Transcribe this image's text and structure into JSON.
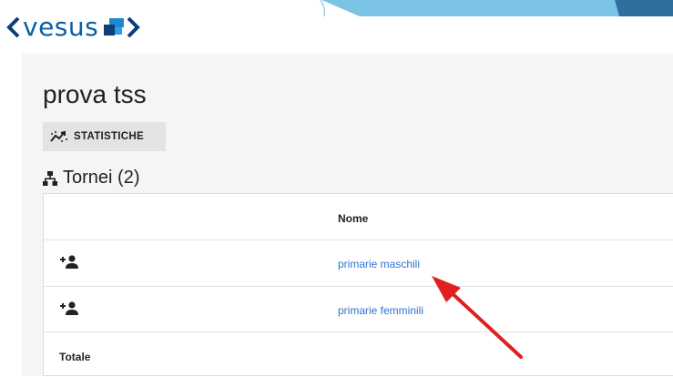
{
  "brand": {
    "logo_text": "vesus"
  },
  "page": {
    "title": "prova tss"
  },
  "toolbar": {
    "statistics_label": "STATISTICHE"
  },
  "section": {
    "heading": "Tornei (2)"
  },
  "table": {
    "header_name": "Nome",
    "rows": [
      {
        "action_icon": "add-person-icon",
        "name": "primarie maschili"
      },
      {
        "action_icon": "add-person-icon",
        "name": "primarie femminili"
      }
    ],
    "footer_label": "Totale"
  },
  "colors": {
    "brand": "#0b5fa5",
    "link": "#2f74d0",
    "annotation_arrow": "#e02020",
    "card_bg": "#f5f5f5"
  }
}
